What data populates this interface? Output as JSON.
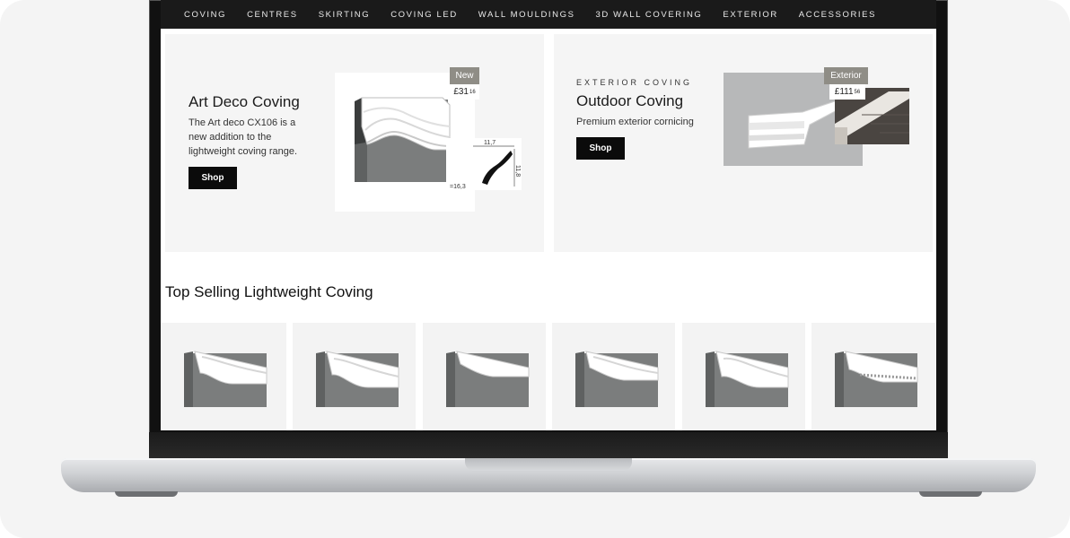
{
  "nav": {
    "items": [
      "COVING",
      "CENTRES",
      "SKIRTING",
      "COVING LED",
      "WALL MOULDINGS",
      "3D WALL COVERING",
      "EXTERIOR",
      "ACCESSORIES"
    ]
  },
  "promo_left": {
    "title": "Art Deco Coving",
    "text": "The Art deco CX106 is a new addition to the lightweight coving range.",
    "button": "Shop",
    "badge": "New",
    "price": "£31",
    "price_pence": "16",
    "dims": {
      "width": "11,7",
      "height": "11,8",
      "angle": "=16,3"
    }
  },
  "promo_right": {
    "eyebrow": "EXTERIOR COVING",
    "title": "Outdoor Coving",
    "text": "Premium exterior cornicing",
    "button": "Shop",
    "badge": "Exterior",
    "price": "£111",
    "price_pence": "56"
  },
  "section": {
    "title": "Top Selling Lightweight Coving"
  },
  "products": [
    {
      "icon": "coving-product-icon"
    },
    {
      "icon": "coving-product-icon"
    },
    {
      "icon": "coving-product-icon"
    },
    {
      "icon": "coving-product-icon"
    },
    {
      "icon": "coving-product-icon"
    },
    {
      "icon": "coving-product-icon"
    }
  ],
  "colors": {
    "nav_bg": "#1a1a1a",
    "panel_bg": "#f5f5f5",
    "badge_bg": "#8f8d86",
    "button_bg": "#0b0b0b",
    "wall_grey": "#7a7c7c"
  }
}
